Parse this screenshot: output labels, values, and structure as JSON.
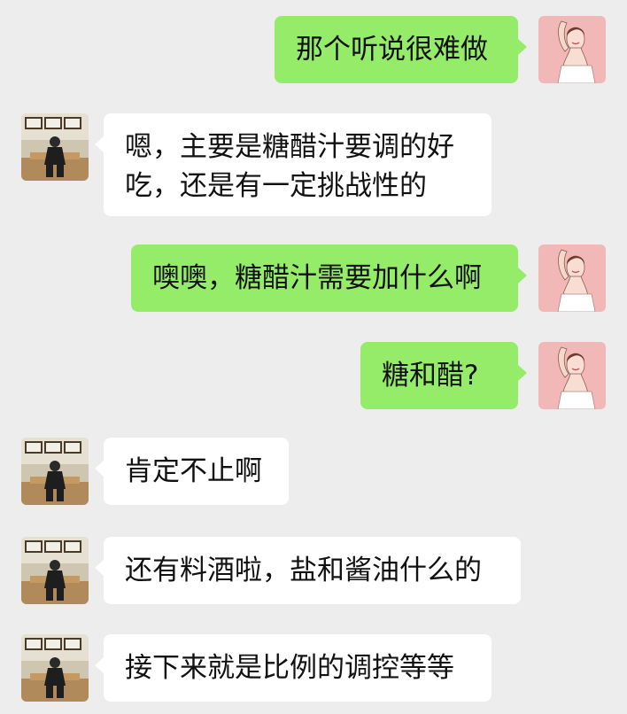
{
  "messages": [
    {
      "sender": "me",
      "lines": [
        "那个听说很难做"
      ]
    },
    {
      "sender": "friend",
      "lines": [
        "嗯，主要是糖醋汁要调的好",
        "吃，还是有一定挑战性的"
      ]
    },
    {
      "sender": "me",
      "lines": [
        "噢噢，糖醋汁需要加什么啊"
      ]
    },
    {
      "sender": "me",
      "lines": [
        "糖和醋?"
      ]
    },
    {
      "sender": "friend",
      "lines": [
        "肯定不止啊"
      ]
    },
    {
      "sender": "friend",
      "lines": [
        "还有料酒啦，盐和酱油什么的"
      ]
    },
    {
      "sender": "friend",
      "lines": [
        "接下来就是比例的调控等等"
      ]
    }
  ],
  "colors": {
    "background": "#ededed",
    "outgoing_bubble": "#95ec69",
    "incoming_bubble": "#ffffff",
    "my_avatar_bg": "#f2b8b8"
  },
  "avatars": {
    "me": "woman-portrait-avatar",
    "friend": "man-sitting-photo-avatar"
  }
}
